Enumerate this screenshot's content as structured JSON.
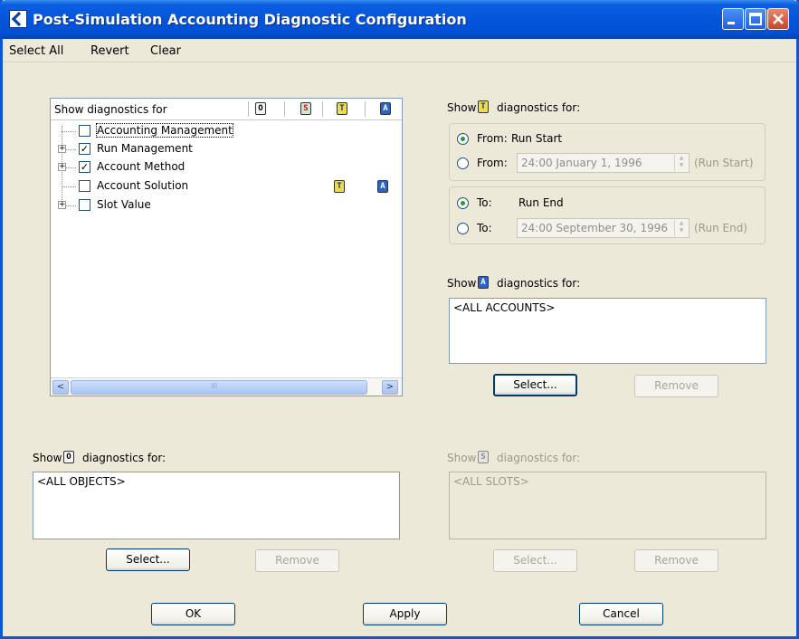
{
  "window": {
    "title": "Post-Simulation Accounting Diagnostic Configuration"
  },
  "menu": [
    "Select All",
    "Revert",
    "Clear"
  ],
  "tree": {
    "header": "Show diagnostics for",
    "column_icons": [
      "objects-icon",
      "slots-icon",
      "time-icon",
      "accounts-icon"
    ],
    "column_icon_letters": [
      "O",
      "S",
      "T",
      "A"
    ],
    "rows": [
      {
        "label": "Accounting Management",
        "checked": false,
        "expandable": false
      },
      {
        "label": "Run Management",
        "checked": true,
        "expandable": true
      },
      {
        "label": "Account Method",
        "checked": true,
        "expandable": true
      },
      {
        "label": "Account Solution",
        "checked": false,
        "expandable": false
      },
      {
        "label": "Slot Value",
        "checked": false,
        "expandable": true
      }
    ],
    "scroll_glyphs": {
      "left": "<",
      "right": ">",
      "grip": "III"
    }
  },
  "time_section": {
    "show_prefix": "Show",
    "show_suffix": "diagnostics for:",
    "from": {
      "opt1_label": "From:",
      "opt1_value": "Run Start",
      "opt2_label": "From:",
      "opt2_date": "24:00 January 1, 1996",
      "opt2_hint": "(Run Start)"
    },
    "to": {
      "opt1_label": "To:",
      "opt1_value": "Run End",
      "opt2_label": "To:",
      "opt2_date": "24:00 September 30, 1996",
      "opt2_hint": "(Run End)"
    }
  },
  "accounts_section": {
    "show_prefix": "Show",
    "show_suffix": "diagnostics for:",
    "list_item": "<ALL ACCOUNTS>",
    "select_label": "Select...",
    "remove_label": "Remove"
  },
  "objects_section": {
    "show_prefix": "Show",
    "show_suffix": "diagnostics for:",
    "list_item": "<ALL OBJECTS>",
    "select_label": "Select...",
    "remove_label": "Remove"
  },
  "slots_section": {
    "show_prefix": "Show",
    "show_suffix": "diagnostics for:",
    "list_item": "<ALL SLOTS>",
    "select_label": "Select...",
    "remove_label": "Remove"
  },
  "buttons": {
    "ok": "OK",
    "apply": "Apply",
    "cancel": "Cancel"
  },
  "colors": {
    "title_bar": "#0454db",
    "dialog_bg": "#ece9d8",
    "radio_dot": "#21a121",
    "icon_T": "#f0dc4a",
    "icon_A": "#2b63c8"
  }
}
